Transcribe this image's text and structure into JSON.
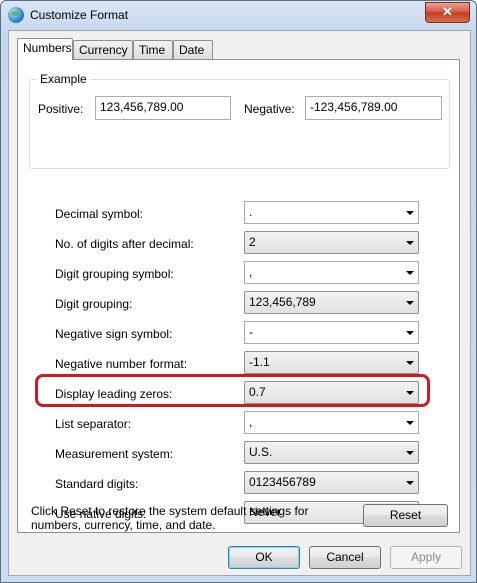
{
  "window": {
    "title": "Customize Format",
    "close_label": "✕"
  },
  "tabs": [
    {
      "label": "Numbers",
      "active": true
    },
    {
      "label": "Currency",
      "active": false
    },
    {
      "label": "Time",
      "active": false
    },
    {
      "label": "Date",
      "active": false
    }
  ],
  "example": {
    "legend": "Example",
    "positive_label": "Positive:",
    "positive_value": "123,456,789.00",
    "negative_label": "Negative:",
    "negative_value": "-123,456,789.00"
  },
  "settings": [
    {
      "label": "Decimal symbol:",
      "value": ".",
      "editable": true
    },
    {
      "label": "No. of digits after decimal:",
      "value": "2",
      "editable": false
    },
    {
      "label": "Digit grouping symbol:",
      "value": ",",
      "editable": true
    },
    {
      "label": "Digit grouping:",
      "value": "123,456,789",
      "editable": false
    },
    {
      "label": "Negative sign symbol:",
      "value": "-",
      "editable": true
    },
    {
      "label": "Negative number format:",
      "value": "-1.1",
      "editable": false
    },
    {
      "label": "Display leading zeros:",
      "value": "0.7",
      "editable": false
    },
    {
      "label": "List separator:",
      "value": ",",
      "editable": true,
      "highlighted": true
    },
    {
      "label": "Measurement system:",
      "value": "U.S.",
      "editable": false
    },
    {
      "label": "Standard digits:",
      "value": "0123456789",
      "editable": false
    },
    {
      "label": "Use native digits:",
      "value": "Never",
      "editable": false
    }
  ],
  "reset_info": "Click Reset to restore the system default settings for numbers, currency, time, and date.",
  "buttons": {
    "reset": "Reset",
    "ok": "OK",
    "cancel": "Cancel",
    "apply": "Apply"
  },
  "colors": {
    "highlight": "#d21922",
    "accent": "#3c7fb1"
  }
}
